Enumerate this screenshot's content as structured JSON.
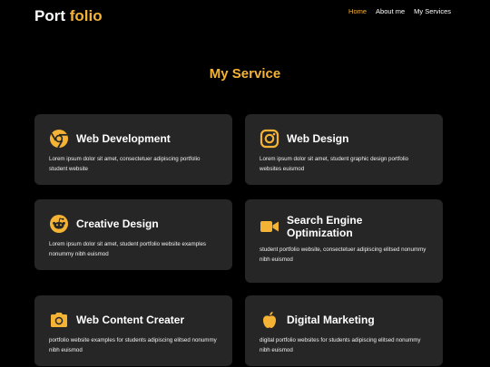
{
  "brand": {
    "logo_main": "Port",
    "logo_accent": "folio",
    "accent_color": "#f5b335"
  },
  "nav": {
    "items": [
      {
        "label": "Home",
        "active": true
      },
      {
        "label": "About me",
        "active": false
      },
      {
        "label": "My Services",
        "active": false
      }
    ]
  },
  "services": {
    "title": "My Service",
    "cards": [
      {
        "icon": "chrome-icon",
        "title": "Web Development",
        "description": "Lorem ipsum dolor sit amet, consectetuer adipiscing portfolio student website"
      },
      {
        "icon": "instagram-icon",
        "title": "Web Design",
        "description": "Lorem ipsum dolor sit amet, student graphic design portfolio websites euismod"
      },
      {
        "icon": "reddit-icon",
        "title": "Creative Design",
        "description": "Lorem ipsum dolor sit amet, student portfolio website examples nonummy nibh euismod"
      },
      {
        "icon": "video-camera-icon",
        "title": "Search Engine Optimization",
        "description": "student portfolio website, consectetuer adipiscing elitsed nonummy nibh euismod"
      },
      {
        "icon": "camera-icon",
        "title": "Web Content Creater",
        "description": "portfolio website examples for students adipiscing elitsed nonummy nibh euismod"
      },
      {
        "icon": "apple-icon",
        "title": "Digital Marketing",
        "description": "digital portfolio websites for students adipiscing elitsed nonummy nibh euismod"
      }
    ]
  }
}
